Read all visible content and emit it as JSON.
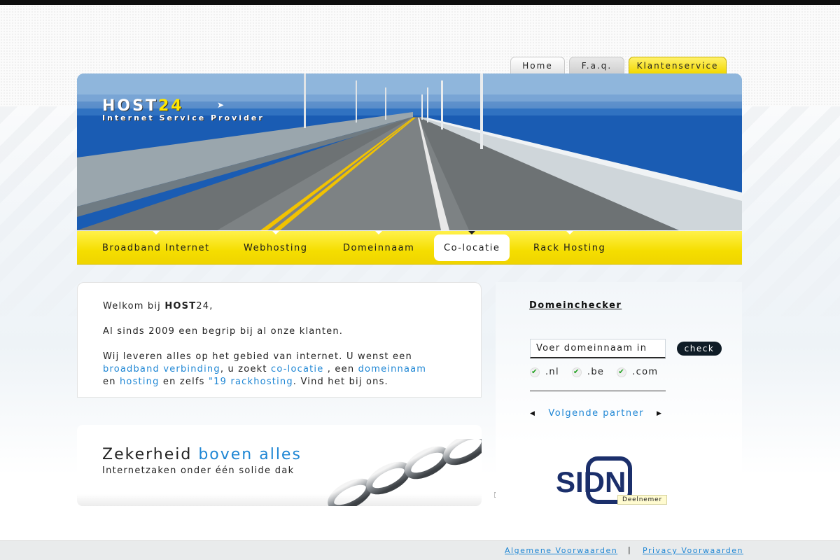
{
  "tabs": {
    "home": "Home",
    "faq": "F.a.q.",
    "klantenservice": "Klantenservice"
  },
  "logo": {
    "host_prefix": "HOST",
    "host_suffix": "24",
    "tagline": "Internet Service Provider"
  },
  "nav": [
    {
      "label": "Broadband Internet"
    },
    {
      "label": "Webhosting"
    },
    {
      "label": "Domeinnaam"
    },
    {
      "label": "Co-locatie",
      "active": true
    },
    {
      "label": "Rack Hosting"
    }
  ],
  "welcome": {
    "greeting_prefix": "Welkom bij ",
    "greeting_brand": "HOST",
    "greeting_suffix": "24,",
    "since": "Al sinds 2009 een begrip bij al onze klanten.",
    "intro": "Wij leveren alles op het gebied van internet. U wenst een",
    "link_broadband": "broadband verbinding",
    "text_1": ", u zoekt ",
    "link_colocatie": "co-locatie",
    "text_2": " , een ",
    "link_domeinnaam": "domeinnaam",
    "text_3": "en ",
    "link_hosting": "hosting",
    "text_4": " en zelfs ",
    "link_rack": "\"19 rackhosting",
    "text_5": ". Vind het bij ons."
  },
  "promo": {
    "title_black": "Zekerheid ",
    "title_blue": "boven alles",
    "subtitle": "Internetzaken onder één solide dak"
  },
  "domeinchecker": {
    "title": "Domeinchecker",
    "input_value": "Voer domeinnaam in",
    "check_label": "check",
    "extensions": [
      ".nl",
      ".be",
      ".com"
    ],
    "partner_label": "Volgende partner"
  },
  "sidn": {
    "logo_text": "SIDN",
    "badge": "Deelnemer"
  },
  "footer": {
    "terms": "Algemene Voorwaarden",
    "separator": "|",
    "privacy": "Privacy Voorwaarden"
  },
  "colors": {
    "accent_yellow": "#f5de00",
    "link_blue": "#1e86d4",
    "sea_blue": "#184f9e",
    "dark": "#0f1c26"
  }
}
